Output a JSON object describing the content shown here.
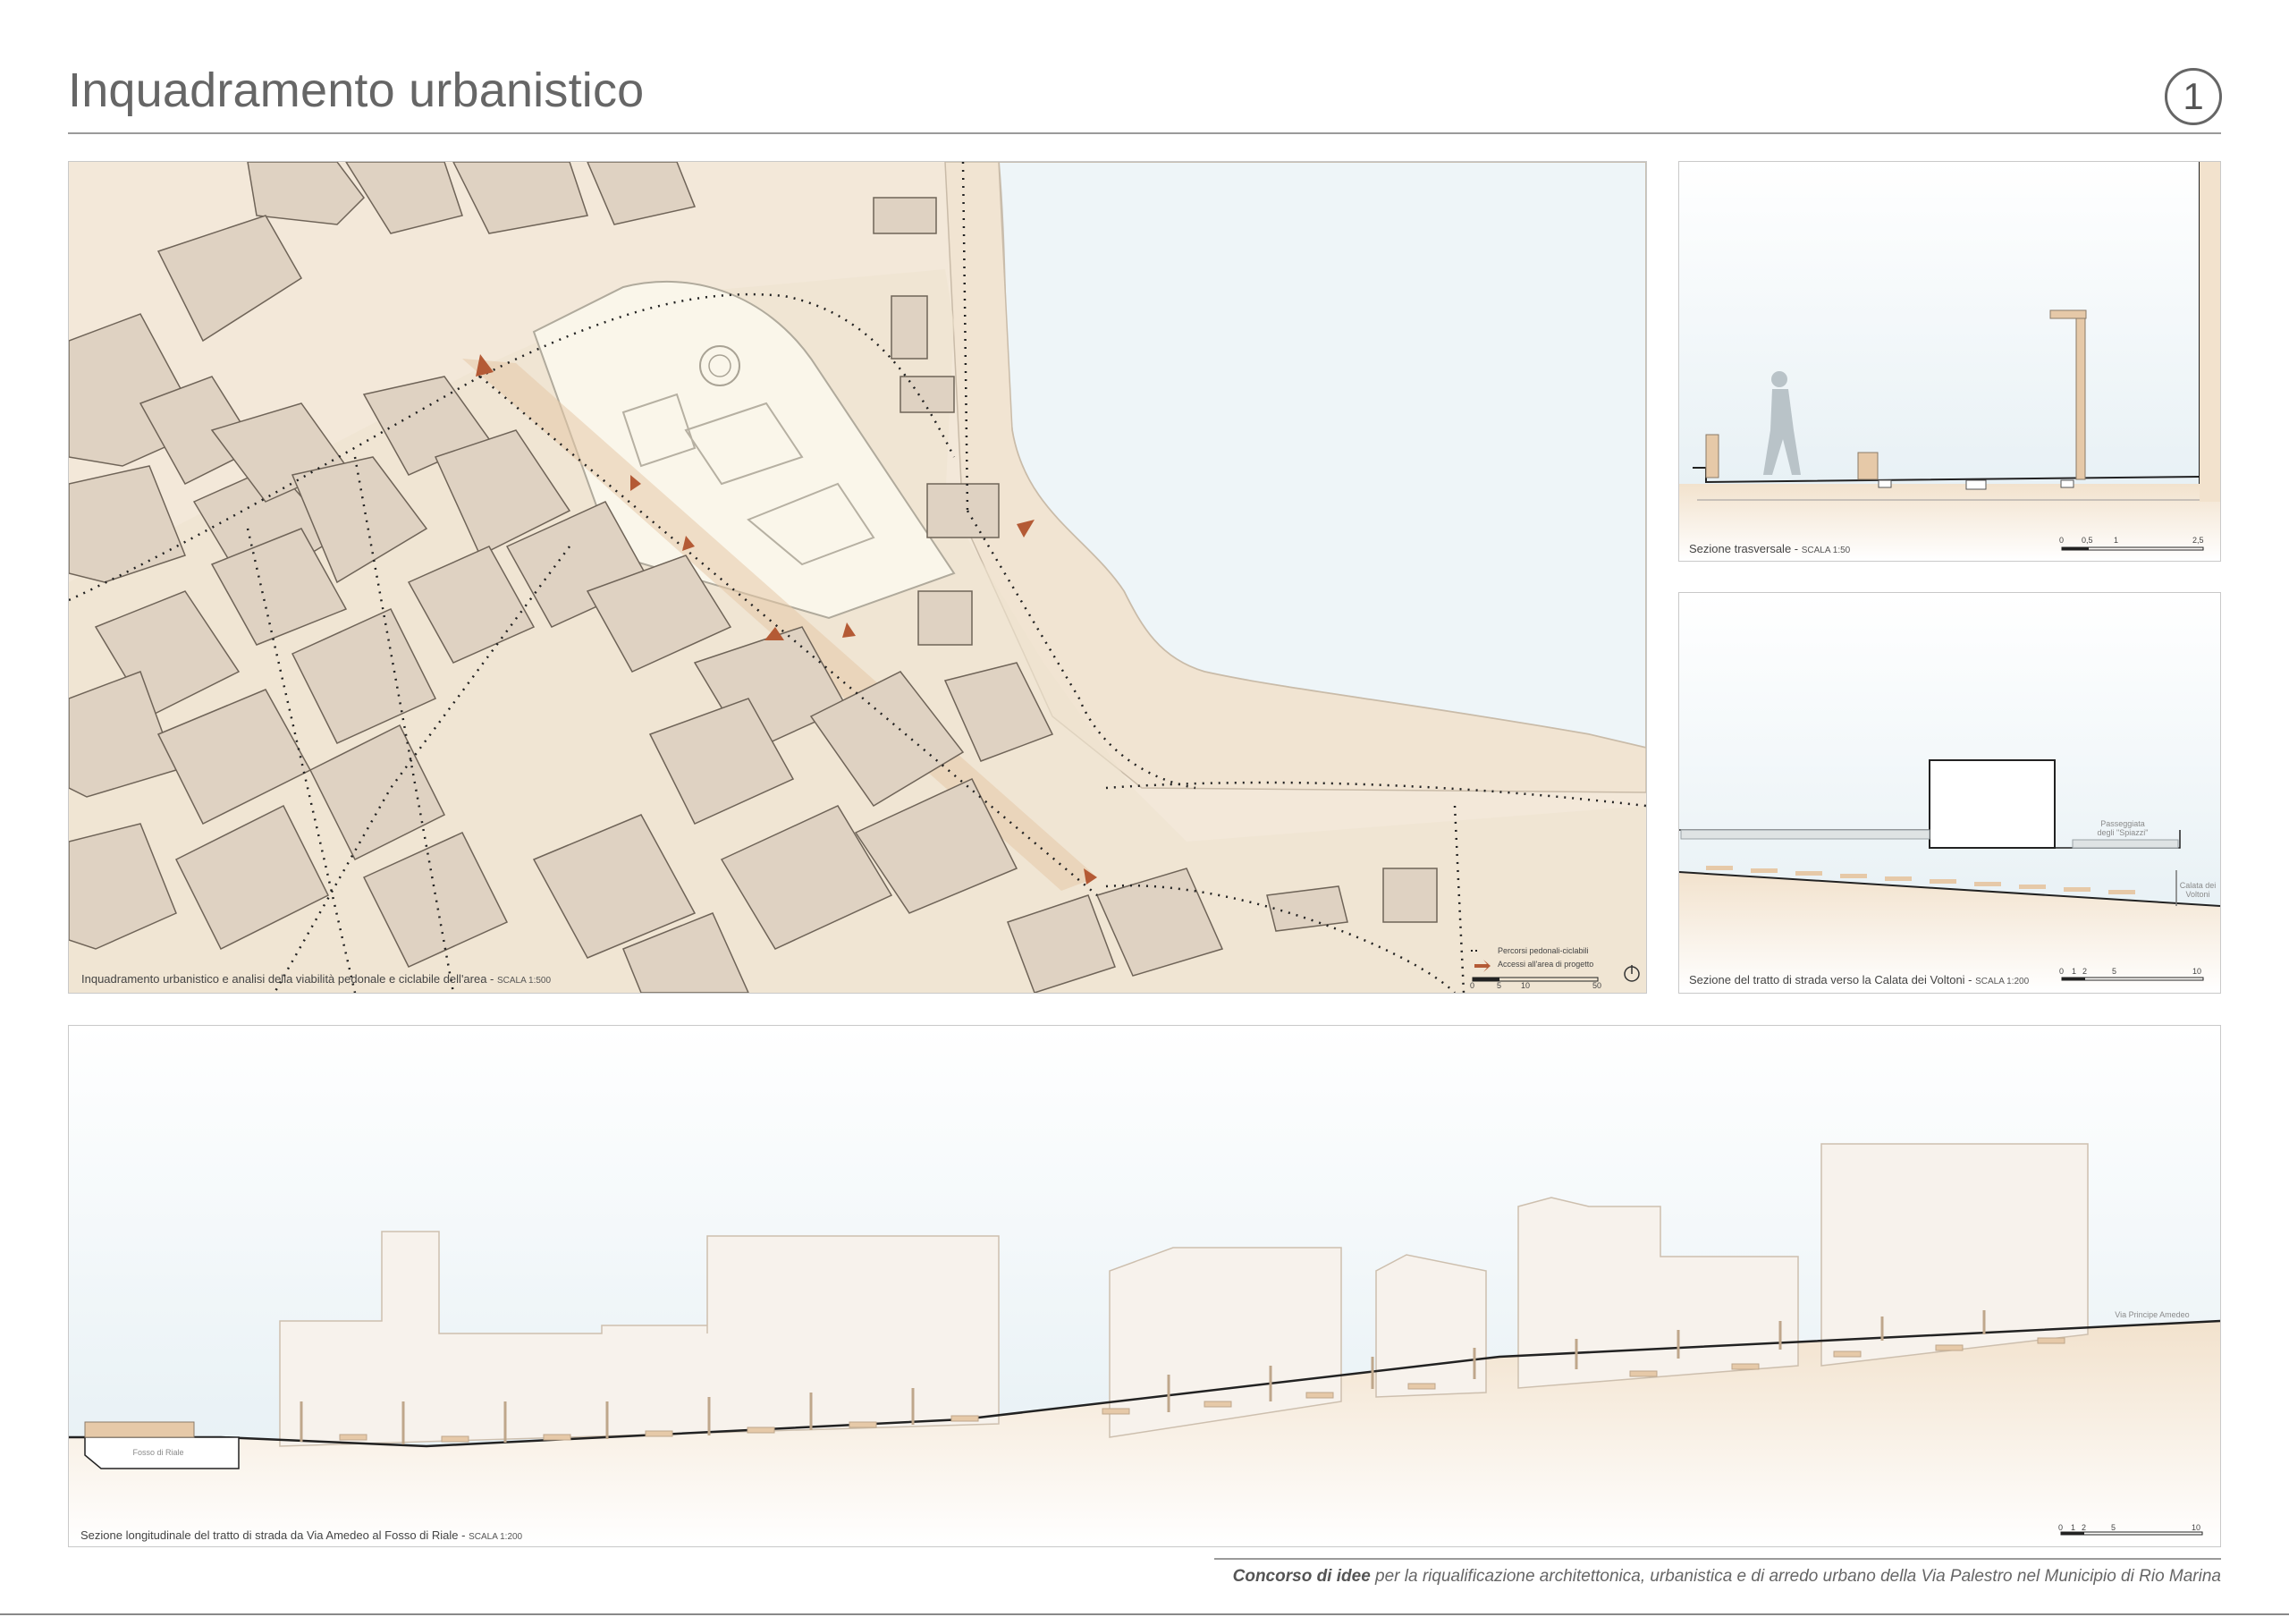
{
  "header": {
    "title": "Inquadramento urbanistico",
    "page_number": "1"
  },
  "map_panel": {
    "caption": "Inquadramento urbanistico e analisi della viabilità pedonale e ciclabile dell'area - ",
    "scale": "SCALA 1:500",
    "legend": {
      "paths_label": "Percorsi pedonali-ciclabili",
      "access_label": "Accessi all'area di progetto"
    },
    "scale_ticks": [
      "0",
      "5",
      "10",
      "50"
    ],
    "colors": {
      "building": "#dfd2c2",
      "ground": "#f3e8d9",
      "sea": "#eef5f8",
      "park": "#faf6ea",
      "arrow": "#b45a35"
    }
  },
  "cross_section": {
    "caption": "Sezione trasversale - ",
    "scale": "SCALA 1:50",
    "scale_ticks": [
      "0",
      "0,5",
      "1",
      "2,5"
    ]
  },
  "road_section": {
    "caption": "Sezione del tratto di strada verso la Calata dei Voltoni - ",
    "scale": "SCALA 1:200",
    "label_passeggiata": "Passeggiata degli \"Spiazzi\"",
    "label_calata": "Calata dei Voltoni",
    "scale_ticks": [
      "0",
      "1",
      "2",
      "5",
      "10"
    ]
  },
  "long_section": {
    "caption": "Sezione longitudinale del tratto di strada da Via Amedeo al Fosso di Riale - ",
    "scale": "SCALA 1:200",
    "label_fosso": "Fosso di Riale",
    "label_via": "Via Principe Amedeo",
    "scale_ticks": [
      "0",
      "1",
      "2",
      "5",
      "10"
    ]
  },
  "footer": {
    "bold_text": "Concorso di idee",
    "text": " per la riqualificazione architettonica, urbanistica e di arredo urbano della Via Palestro nel Municipio di Rio Marina"
  }
}
